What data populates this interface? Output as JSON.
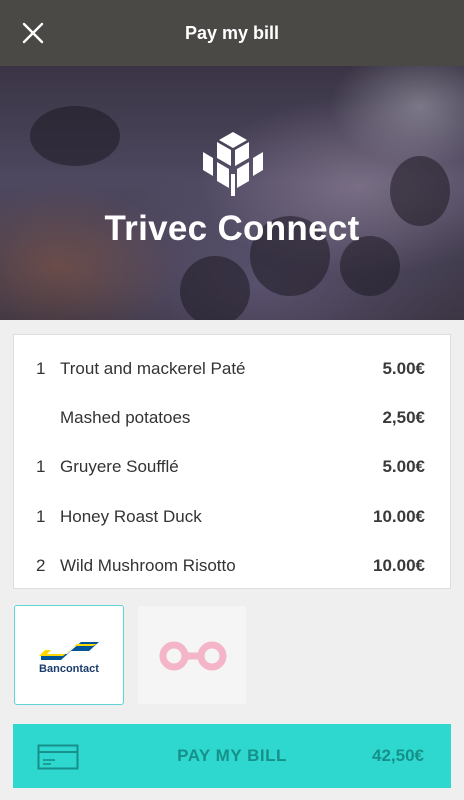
{
  "header": {
    "title": "Pay my bill"
  },
  "hero": {
    "brand": "Trivec Connect"
  },
  "bill": {
    "items": [
      {
        "qty": "1",
        "name": "Trout and mackerel Paté",
        "price": "5.00€"
      },
      {
        "qty": "",
        "name": "Mashed potatoes",
        "price": "2,50€"
      },
      {
        "qty": "1",
        "name": "Gruyere Soufflé",
        "price": "5.00€"
      },
      {
        "qty": "1",
        "name": "Honey Roast Duck",
        "price": "10.00€"
      },
      {
        "qty": "2",
        "name": "Wild Mushroom Risotto",
        "price": "10.00€"
      }
    ]
  },
  "payment_methods": {
    "bancontact": {
      "label": "Bancontact",
      "selected": true
    },
    "other": {
      "icon": "infinity-icon",
      "selected": false
    }
  },
  "pay_button": {
    "label": "PAY MY BILL",
    "total": "42,50€"
  },
  "colors": {
    "topbar": "#4b4946",
    "accent": "#2fd8cf",
    "accent_text": "#16908a",
    "selected_border": "#5fd3d6",
    "infinity": "#f4b5c8"
  }
}
